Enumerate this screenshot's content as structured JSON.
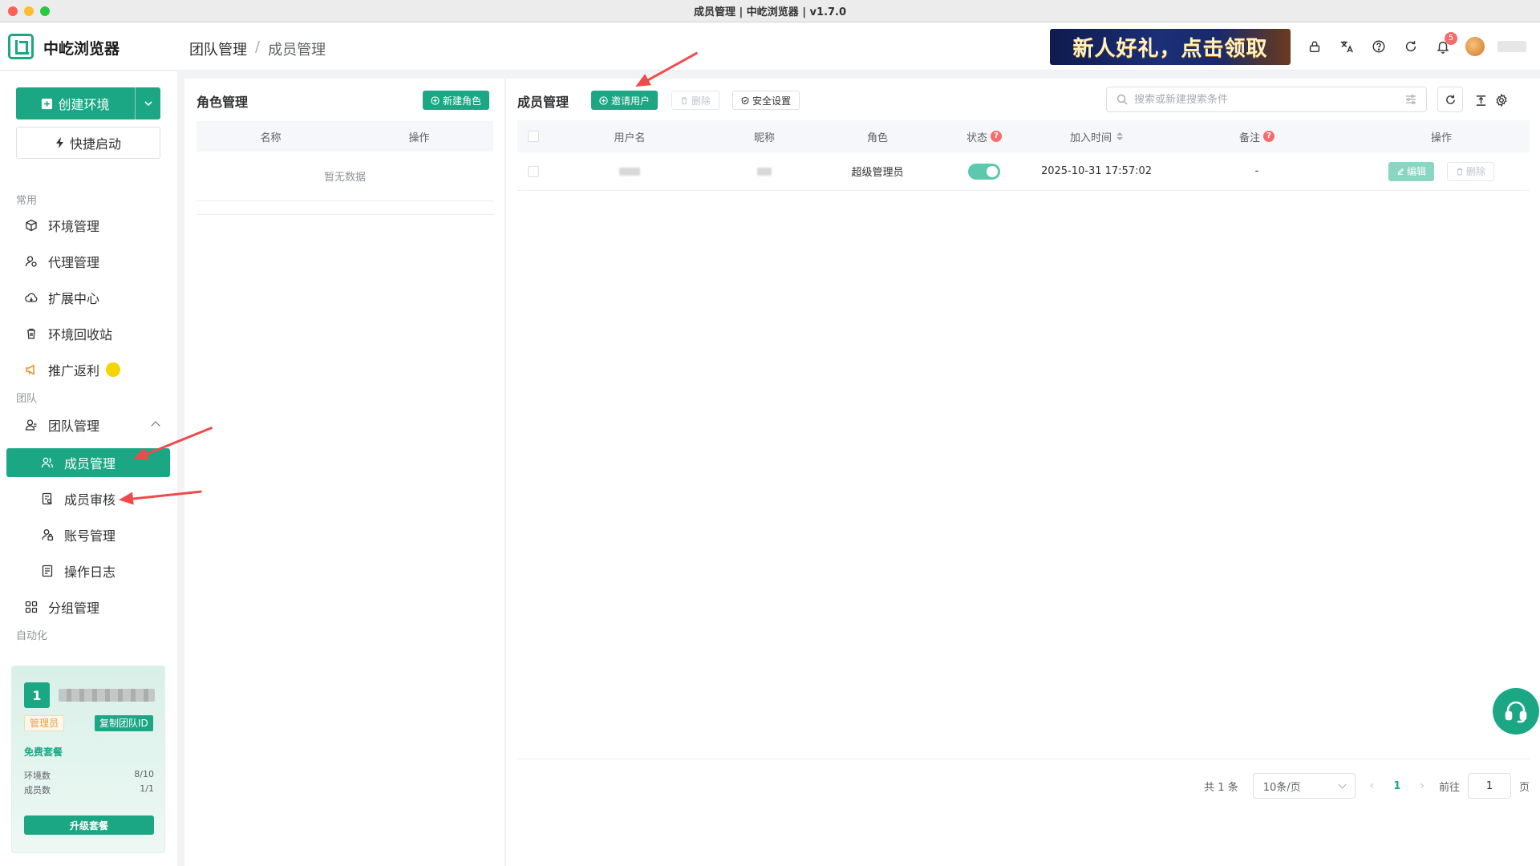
{
  "window": {
    "title": "成员管理 | 中屹浏览器 | v1.7.0"
  },
  "header": {
    "brand": "中屹浏览器",
    "breadcrumb": [
      "团队管理",
      "成员管理"
    ],
    "promo_text": "新人好礼，点击领取",
    "notification_count": "5",
    "icons": [
      "lock-icon",
      "translate-icon",
      "help-icon",
      "refresh-icon",
      "bell-icon"
    ]
  },
  "sidebar": {
    "create_label": "创建环境",
    "quick_label": "快捷启动",
    "groups": {
      "common": "常用",
      "team": "团队",
      "automation": "自动化"
    },
    "common_items": [
      {
        "label": "环境管理",
        "icon": "cube-icon"
      },
      {
        "label": "代理管理",
        "icon": "proxy-user-icon"
      },
      {
        "label": "扩展中心",
        "icon": "cloud-icon"
      },
      {
        "label": "环境回收站",
        "icon": "trash-icon"
      },
      {
        "label": "推广返利",
        "icon": "megaphone-icon"
      }
    ],
    "team_menu": {
      "label": "团队管理",
      "expanded": true
    },
    "team_items": [
      {
        "label": "成员管理",
        "active": true,
        "icon": "users-icon"
      },
      {
        "label": "成员审核",
        "icon": "review-icon"
      },
      {
        "label": "账号管理",
        "icon": "account-lock-icon"
      },
      {
        "label": "操作日志",
        "icon": "log-icon"
      }
    ],
    "group_item": {
      "label": "分组管理",
      "icon": "group-icon"
    },
    "team_card": {
      "number": "1",
      "role_tag": "管理员",
      "copy_label": "复制团队ID",
      "plan": "免费套餐",
      "stats": [
        {
          "label": "环境数",
          "value": "8/10"
        },
        {
          "label": "成员数",
          "value": "1/1"
        }
      ],
      "upgrade_label": "升级套餐"
    }
  },
  "roles": {
    "title": "角色管理",
    "new_label": "新建角色",
    "columns": [
      "名称",
      "操作"
    ],
    "empty_text": "暂无数据"
  },
  "members": {
    "title": "成员管理",
    "toolbar": {
      "invite": "邀请用户",
      "delete": "删除",
      "security": "安全设置"
    },
    "search_placeholder": "搜索或新建搜索条件",
    "columns": {
      "username": "用户名",
      "nickname": "昵称",
      "role": "角色",
      "status": "状态",
      "joined": "加入时间",
      "note": "备注",
      "ops": "操作"
    },
    "rows": [
      {
        "role": "超级管理员",
        "status_on": true,
        "joined": "2025-10-31 17:57:02",
        "note": "-",
        "edit": "编辑",
        "delete": "删除"
      }
    ],
    "pagination": {
      "total": "共 1 条",
      "page_size": "10条/页",
      "current_page": "1",
      "goto_label": "前往",
      "goto_value": "1",
      "page_unit": "页"
    }
  },
  "colors": {
    "accent": "#1ba784",
    "danger": "#f56c6c",
    "annotation_arrow": "#f04a4a"
  }
}
